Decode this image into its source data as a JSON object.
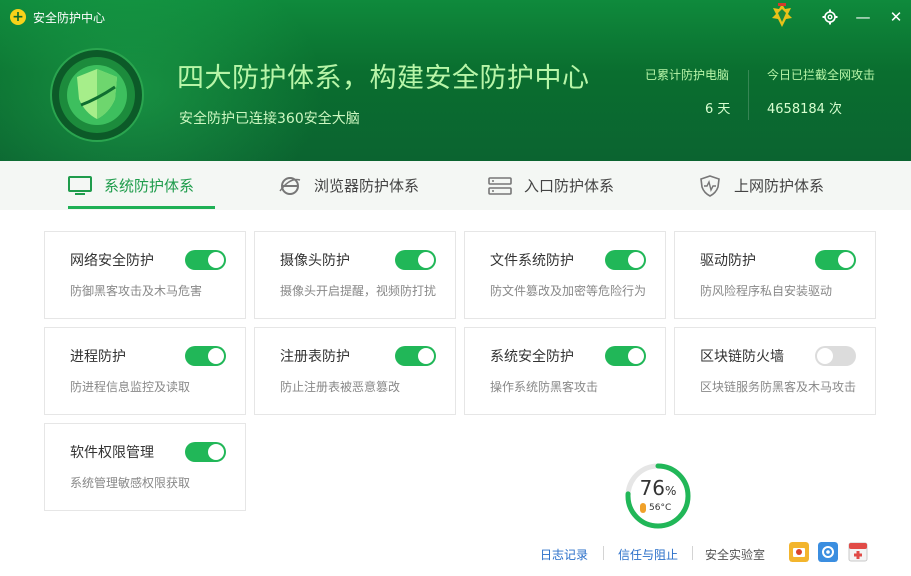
{
  "app": {
    "title": "安全防护中心"
  },
  "header": {
    "headline": "四大防护体系，构建安全防护中心",
    "subline": "安全防护已连接360安全大脑",
    "stats": [
      {
        "label": "已累计防护电脑",
        "value": "6 天"
      },
      {
        "label": "今日已拦截全网攻击",
        "value": "4658184 次"
      }
    ]
  },
  "tabs": [
    {
      "label": "系统防护体系",
      "icon": "monitor-icon",
      "active": true
    },
    {
      "label": "浏览器防护体系",
      "icon": "browser-icon",
      "active": false
    },
    {
      "label": "入口防护体系",
      "icon": "gateway-icon",
      "active": false
    },
    {
      "label": "上网防护体系",
      "icon": "shield-pulse-icon",
      "active": false
    }
  ],
  "cards": [
    {
      "title": "网络安全防护",
      "desc": "防御黑客攻击及木马危害",
      "enabled": true
    },
    {
      "title": "摄像头防护",
      "desc": "摄像头开启提醒，视频防打扰",
      "enabled": true
    },
    {
      "title": "文件系统防护",
      "desc": "防文件篡改及加密等危险行为",
      "enabled": true
    },
    {
      "title": "驱动防护",
      "desc": "防风险程序私自安装驱动",
      "enabled": true
    },
    {
      "title": "进程防护",
      "desc": "防进程信息监控及读取",
      "enabled": true
    },
    {
      "title": "注册表防护",
      "desc": "防止注册表被恶意篡改",
      "enabled": true
    },
    {
      "title": "系统安全防护",
      "desc": "操作系统防黑客攻击",
      "enabled": true
    },
    {
      "title": "区块链防火墙",
      "desc": "区块链服务防黑客及木马攻击",
      "enabled": false
    },
    {
      "title": "软件权限管理",
      "desc": "系统管理敏感权限获取",
      "enabled": true
    }
  ],
  "gauge": {
    "value": "76",
    "unit": "%",
    "temp": "56°C",
    "fraction": 0.76
  },
  "footer": {
    "log": "日志记录",
    "trust": "信任与阻止",
    "lab": "安全实验室"
  },
  "colors": {
    "brand_green": "#21b758",
    "header_green": "#0b6a2e",
    "link_blue": "#2a6fc9"
  }
}
